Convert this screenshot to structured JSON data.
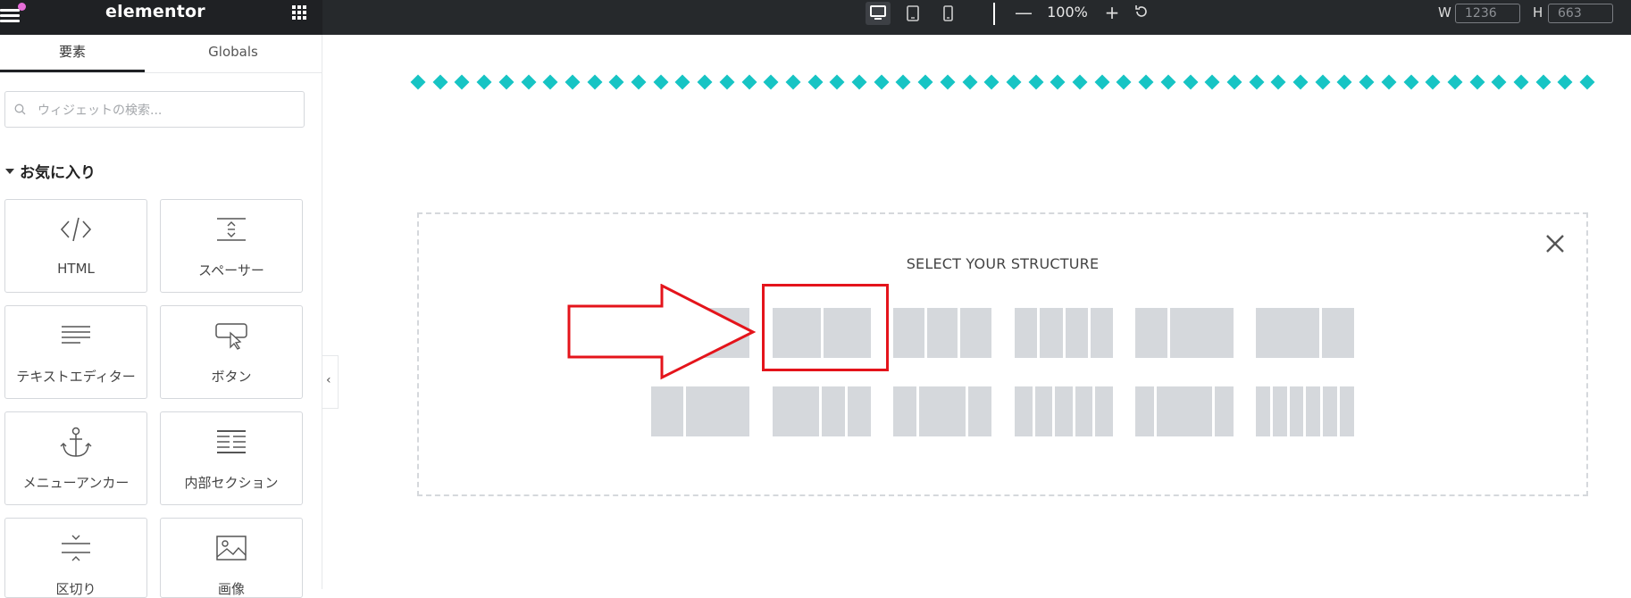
{
  "topbar": {
    "logo": "elementor",
    "zoom": "100%",
    "zoom_minus": "—",
    "zoom_plus": "+",
    "width_label": "W",
    "width_value": "1236",
    "height_label": "H",
    "height_value": "663",
    "devices": [
      "desktop-icon",
      "tablet-icon",
      "mobile-icon"
    ]
  },
  "sidebar": {
    "tabs": [
      {
        "label": "要素",
        "active": true
      },
      {
        "label": "Globals",
        "active": false
      }
    ],
    "search_placeholder": "ウィジェットの検索...",
    "favorites_title": "お気に入り",
    "widgets": [
      {
        "label": "HTML",
        "icon": "code-icon"
      },
      {
        "label": "スペーサー",
        "icon": "spacer-icon"
      },
      {
        "label": "テキストエディター",
        "icon": "text-editor-icon"
      },
      {
        "label": "ボタン",
        "icon": "button-icon"
      },
      {
        "label": "メニューアンカー",
        "icon": "anchor-icon"
      },
      {
        "label": "内部セクション",
        "icon": "inner-section-icon"
      },
      {
        "label": "区切り",
        "icon": "divider-icon"
      },
      {
        "label": "画像",
        "icon": "image-icon"
      }
    ],
    "collapse_glyph": "‹"
  },
  "canvas": {
    "structure_title": "SELECT YOUR STRUCTURE",
    "presets_row1": [
      [
        1
      ],
      [
        1,
        1
      ],
      [
        1,
        1,
        1
      ],
      [
        1,
        1,
        1,
        1
      ],
      [
        1,
        2
      ],
      [
        2,
        1
      ]
    ],
    "presets_row2": [
      [
        1,
        2
      ],
      [
        2,
        1,
        1
      ],
      [
        1,
        2,
        1
      ],
      [
        1,
        1,
        1,
        1,
        1
      ],
      [
        1,
        3,
        1
      ],
      [
        1,
        1,
        1,
        1,
        1,
        1
      ]
    ],
    "highlighted_preset": "2-columns",
    "colors": {
      "diamonds": "#17c4c4",
      "highlight": "#e4141b",
      "preset_fill": "#d5d8dc"
    }
  }
}
